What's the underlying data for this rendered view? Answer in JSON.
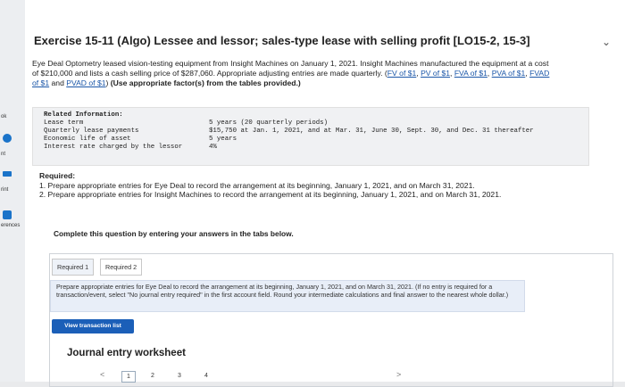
{
  "sidebar": {
    "items": [
      {
        "label": "ok",
        "icon": "book-icon"
      },
      {
        "label": "",
        "icon": "help-icon"
      },
      {
        "label": "nt",
        "icon": "print-icon"
      },
      {
        "label": "rint",
        "icon": "print-icon"
      },
      {
        "label": "erences",
        "icon": "references-icon"
      }
    ]
  },
  "exercise": {
    "title": "Exercise 15-11 (Algo) Lessee and lessor; sales-type lease with selling profit [LO15-2, 15-3]",
    "description_text": "Eye Deal Optometry leased vision-testing equipment from Insight Machines on January 1, 2021. Insight Machines manufactured the equipment at a cost of $210,000 and lists a cash selling price of $287,060. Appropriate adjusting entries are made quarterly.",
    "links": [
      "FV of $1",
      "PV of $1",
      "FVA of $1",
      "PVA of $1",
      "FVAD of $1",
      "PVAD of $1"
    ],
    "description_bold": "(Use appropriate factor(s) from the tables provided.)"
  },
  "related_info": {
    "heading": "Related Information:",
    "rows": [
      {
        "label": "Lease term",
        "value": "5 years (20 quarterly periods)"
      },
      {
        "label": "Quarterly lease payments",
        "value": "$15,750 at Jan. 1, 2021, and at Mar. 31, June 30, Sept. 30, and Dec. 31 thereafter"
      },
      {
        "label": "Economic life of asset",
        "value": "5 years"
      },
      {
        "label": "Interest rate charged by the lessor",
        "value": "4%"
      }
    ]
  },
  "required": {
    "heading": "Required:",
    "items": [
      "1. Prepare appropriate entries for Eye Deal to record the arrangement at its beginning, January 1, 2021, and on March 31, 2021.",
      "2. Prepare appropriate entries for Insight Machines to record the arrangement at its beginning, January 1, 2021, and on March 31, 2021."
    ]
  },
  "complete_text": "Complete this question by entering your answers in the tabs below.",
  "tabs": [
    {
      "label": "Required 1",
      "active": true
    },
    {
      "label": "Required 2",
      "active": false
    }
  ],
  "instructions": "Prepare appropriate entries for Eye Deal to record the arrangement at its beginning, January 1, 2021, and on March 31, 2021. (If no entry is required for a transaction/event, select \"No journal entry required\" in the first account field. Round your intermediate calculations and final answer to the nearest whole dollar.)",
  "view_button": "View transaction list",
  "journal": {
    "title": "Journal entry worksheet",
    "prev": "<",
    "next": ">",
    "pages": [
      "1",
      "2",
      "3",
      "4"
    ],
    "current_page": "1"
  }
}
